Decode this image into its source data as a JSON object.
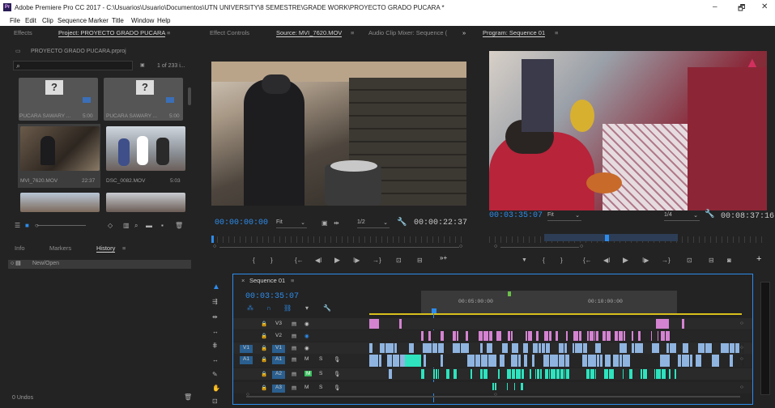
{
  "app": {
    "title": "Adobe Premiere Pro CC 2017 - C:\\Usuarios\\Usuario\\Documentos\\UTN UNIVERSITY\\8 SEMESTRE\\GRADE WORK\\PROYECTO GRADO PUCARA *",
    "badge": "Pr",
    "minimize": "–",
    "maximize": "🗗",
    "close": "✕"
  },
  "menu": [
    "File",
    "Edit",
    "Clip",
    "Sequence",
    "Marker",
    "Title",
    "Window",
    "Help"
  ],
  "project_panel": {
    "tab_effects": "Effects",
    "tab_project": "Project: PROYECTO GRADO PUCARA",
    "tab_menu": "≡",
    "file": "PROYECTO GRADO PUCARA.prproj",
    "item_count": "1 of 233 i...",
    "items": [
      {
        "name": "PUCARA SAWARY ...",
        "duration": "5:00"
      },
      {
        "name": "PUCARA SAWARY ...",
        "duration": "5:00"
      },
      {
        "name": "MVI_7620.MOV",
        "duration": "22:37"
      },
      {
        "name": "DSC_0082.MOV",
        "duration": "5:03"
      }
    ]
  },
  "history_panel": {
    "tab_info": "Info",
    "tab_markers": "Markers",
    "tab_history": "History",
    "tab_menu": "≡",
    "entry": "New/Open",
    "undos": "0 Undos"
  },
  "source_panel": {
    "tab_effect_controls": "Effect Controls",
    "tab_source": "Source: MVI_7620.MOV",
    "tab_menu": "≡",
    "tab_audio": "Audio Clip Mixer: Sequence (",
    "tab_more": "»",
    "timecode": "00:00:00:00",
    "fit": "Fit",
    "resolution": "1/2",
    "duration": "00:00:22:37"
  },
  "program_panel": {
    "tab": "Program: Sequence 01",
    "tab_menu": "≡",
    "timecode": "00:03:35:07",
    "fit": "Fit",
    "resolution": "1/4",
    "duration": "00:08:37:16"
  },
  "timeline": {
    "tab": "Sequence 01",
    "tab_menu": "≡",
    "timecode": "00:03:35:07",
    "ruler": [
      "00:05:00:00",
      "00:10:00:00"
    ],
    "tracks": [
      {
        "src": "",
        "tgt": "V3",
        "name": "",
        "row": "v3"
      },
      {
        "src": "",
        "tgt": "V2",
        "name": "",
        "row": "v2"
      },
      {
        "src": "V1",
        "tgt": "V1",
        "name": "",
        "row": "v1"
      },
      {
        "src": "A1",
        "tgt": "A1",
        "name": "M",
        "solo": "S",
        "row": "a1"
      },
      {
        "src": "",
        "tgt": "A2",
        "name": "M",
        "solo": "S",
        "row": "a2"
      },
      {
        "src": "",
        "tgt": "A3",
        "name": "M",
        "solo": "S",
        "row": "a3"
      }
    ]
  },
  "icons": {
    "play": "▶",
    "step_back": "◀I",
    "step_fwd": "I▶",
    "goto_in": "{←",
    "goto_out": "→}",
    "mark_in": "{",
    "mark_out": "}",
    "marker": "▼",
    "camera": "📷",
    "plus": "+",
    "wrench": "🔧",
    "search": "⌕",
    "lock": "🔒",
    "eye": "👁",
    "mic": "🎙"
  },
  "colors": {
    "video_clip": "#d483d1",
    "audio_clip": "#2ee3be",
    "link_blue": "#2d8ceb",
    "clip_lightblue": "#8fb4e0",
    "playhead": "#2d8ceb"
  }
}
